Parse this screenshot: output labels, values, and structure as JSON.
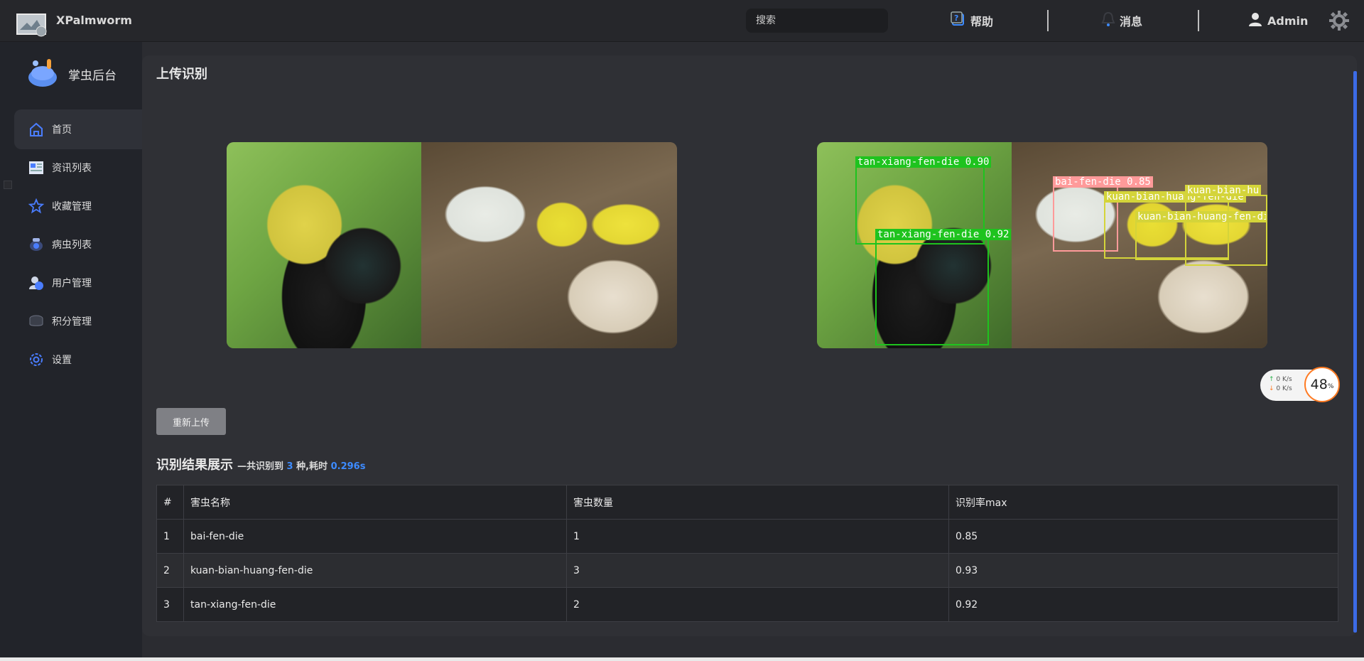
{
  "header": {
    "app_name": "XPalmworm",
    "search_placeholder": "搜索",
    "help_label": "帮助",
    "messages_label": "消息",
    "user_label": "Admin"
  },
  "sidebar": {
    "brand_label": "掌虫后台",
    "items": [
      {
        "label": "首页",
        "icon": "home-icon",
        "active": true
      },
      {
        "label": "资讯列表",
        "icon": "news-icon"
      },
      {
        "label": "收藏管理",
        "icon": "star-icon"
      },
      {
        "label": "病虫列表",
        "icon": "bug-list-icon"
      },
      {
        "label": "用户管理",
        "icon": "users-icon"
      },
      {
        "label": "积分管理",
        "icon": "coins-icon"
      },
      {
        "label": "设置",
        "icon": "gear-icon"
      }
    ]
  },
  "main": {
    "title": "上传识别",
    "reupload_label": "重新上传",
    "detections": [
      {
        "label": "tan-xiang-fen-die  0.90",
        "color": "#1ec31e"
      },
      {
        "label": "tan-xiang-fen-die  0.92",
        "color": "#1ec31e"
      },
      {
        "label": "bai-fen-die  0.85",
        "color": "#ff9a9a"
      },
      {
        "label": "kuan-bian-huang-fen-die",
        "color": "#d4d43a"
      },
      {
        "label": "kuan-bian-huang-fen-die",
        "color": "#d4d43a"
      },
      {
        "label": "kuan-bian-hu",
        "color": "#d4d43a"
      }
    ],
    "result": {
      "title": "识别结果展示",
      "prefix": "—共识别到",
      "count": "3",
      "mid": "种,耗时",
      "time": "0.296s",
      "columns": [
        "#",
        "害虫名称",
        "害虫数量",
        "识别率max"
      ],
      "rows": [
        [
          "1",
          "bai-fen-die",
          "1",
          "0.85"
        ],
        [
          "2",
          "kuan-bian-huang-fen-die",
          "3",
          "0.93"
        ],
        [
          "3",
          "tan-xiang-fen-die",
          "2",
          "0.92"
        ]
      ]
    }
  },
  "speed_widget": {
    "up": "0  K/s",
    "down": "0  K/s",
    "percent": "48",
    "percent_sign": "%"
  },
  "colors": {
    "accent": "#3d8bff",
    "detection_green": "#1ec31e",
    "detection_pink": "#ff9a9a",
    "detection_yellow": "#d4d43a"
  }
}
